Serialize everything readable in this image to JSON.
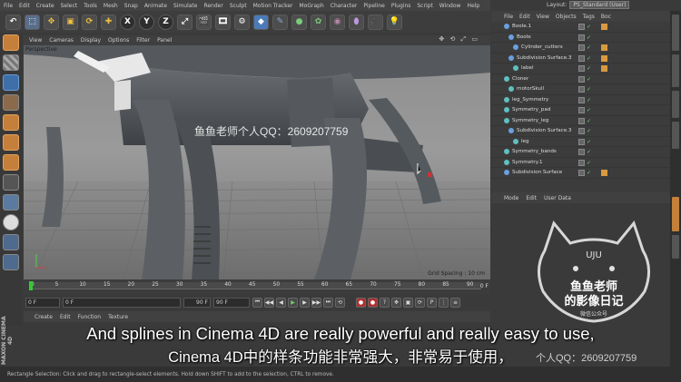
{
  "menubar": {
    "items": [
      "File",
      "Edit",
      "Create",
      "Select",
      "Tools",
      "Mesh",
      "Snap",
      "Animate",
      "Simulate",
      "Render",
      "Sculpt",
      "Motion Tracker",
      "MoGraph",
      "Character",
      "Pipeline",
      "Plugins",
      "Script",
      "Window",
      "Help"
    ]
  },
  "layout": {
    "label": "Layout:",
    "value": "PS_Standard (User)"
  },
  "toolbar": {
    "axis_labels": [
      "X",
      "Y",
      "Z"
    ]
  },
  "viewport": {
    "menu": [
      "View",
      "Cameras",
      "Display",
      "Options",
      "Filter",
      "Panel"
    ],
    "label": "Perspective",
    "grid_spacing": "Grid Spacing : 10 cm"
  },
  "object_manager": {
    "menu": [
      "File",
      "Edit",
      "View",
      "Objects",
      "Tags",
      "Boc"
    ],
    "items": [
      {
        "label": "Boole.1",
        "indent": 0,
        "color": "#6aa0e0",
        "tag": true
      },
      {
        "label": "Boole",
        "indent": 1,
        "color": "#6aa0e0",
        "tag": false
      },
      {
        "label": "Cylinder_cutters",
        "indent": 2,
        "color": "#6aa0e0",
        "tag": true
      },
      {
        "label": "Subdivision Surface.3",
        "indent": 1,
        "color": "#6aa0e0",
        "tag": true
      },
      {
        "label": "label",
        "indent": 2,
        "color": "#60c0c0",
        "tag": true
      },
      {
        "label": "Cloner",
        "indent": 0,
        "color": "#60c0c0",
        "tag": false
      },
      {
        "label": "motorSkull",
        "indent": 1,
        "color": "#60c0c0",
        "tag": false
      },
      {
        "label": "leg_Symmetry",
        "indent": 0,
        "color": "#60c0c0",
        "tag": false
      },
      {
        "label": "Symmetry_pad",
        "indent": 0,
        "color": "#60c0c0",
        "tag": false
      },
      {
        "label": "Symmetry_leg",
        "indent": 0,
        "color": "#60c0c0",
        "tag": false
      },
      {
        "label": "Subdivision Surface.3",
        "indent": 1,
        "color": "#6aa0e0",
        "tag": false
      },
      {
        "label": "leg",
        "indent": 2,
        "color": "#60c0c0",
        "tag": false
      },
      {
        "label": "Symmetry_bands",
        "indent": 0,
        "color": "#60c0c0",
        "tag": false
      },
      {
        "label": "Symmetry.1",
        "indent": 0,
        "color": "#60c0c0",
        "tag": false
      },
      {
        "label": "Subdivision Surface",
        "indent": 0,
        "color": "#6aa0e0",
        "tag": true
      }
    ]
  },
  "attributes": {
    "menu": [
      "Mode",
      "Edit",
      "User Data"
    ]
  },
  "timeline": {
    "ticks": [
      "0",
      "5",
      "10",
      "15",
      "20",
      "25",
      "30",
      "35",
      "40",
      "45",
      "50",
      "55",
      "60",
      "65",
      "70",
      "75",
      "80",
      "85",
      "90"
    ],
    "end_label": "0 F"
  },
  "transport": {
    "start": "0 F",
    "current": "0 F",
    "end": "90 F",
    "end2": "90 F"
  },
  "material_manager": {
    "menu": [
      "Create",
      "Edit",
      "Function",
      "Texture"
    ]
  },
  "status": {
    "text": "Rectangle Selection: Click and drag to rectangle-select elements. Hold down SHIFT to add to the selection, CTRL to remove."
  },
  "subtitles": {
    "english": "And splines in Cinema 4D are really powerful and really easy to use,",
    "chinese": "Cinema 4D中的样条功能非常强大，非常易于使用，"
  },
  "watermark": {
    "viewport_text": "鱼鱼老师个人QQ：2609207759",
    "corner_text": "个人QQ：2609207759"
  },
  "logo": {
    "line1": "鱼鱼老师",
    "line2": "的影像日记",
    "line3": "微信公众号",
    "badge": "UJU"
  },
  "branding": {
    "maxon": "MAXON CINEMA 4D"
  },
  "colors": {
    "accent_orange": "#c4803a",
    "accent_blue": "#3f6fa8",
    "ui_dark": "#3a3a3a"
  }
}
